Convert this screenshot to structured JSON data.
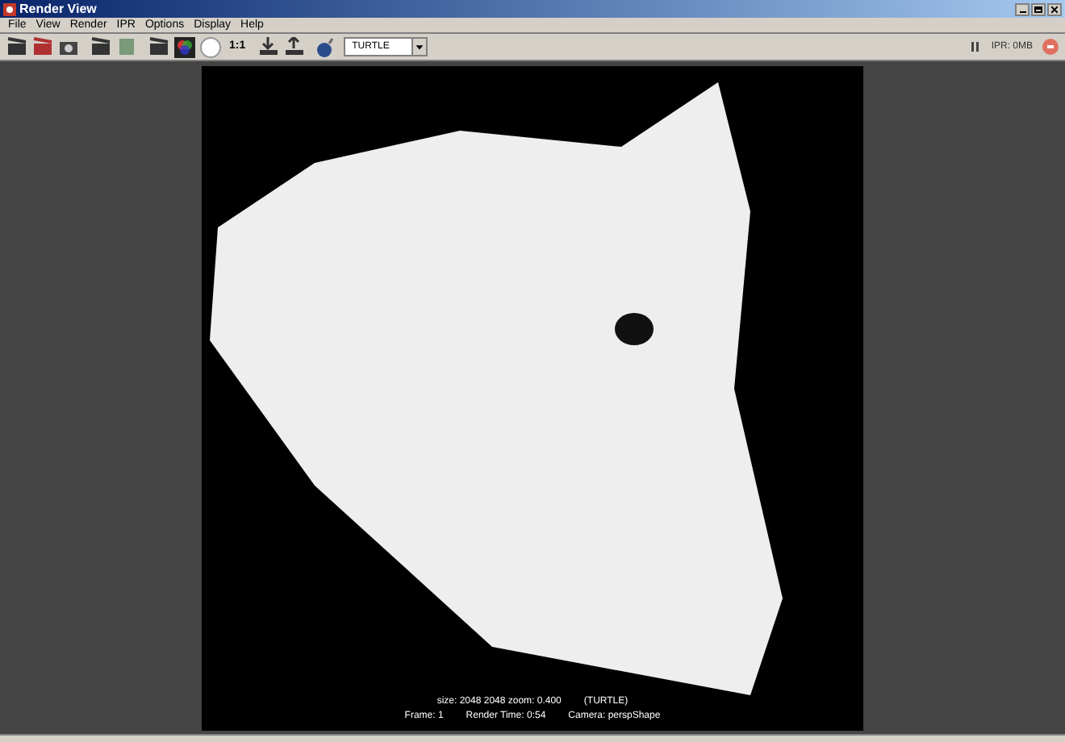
{
  "window": {
    "title": "Render View"
  },
  "menu": [
    "File",
    "View",
    "Render",
    "IPR",
    "Options",
    "Display",
    "Help"
  ],
  "toolbar": {
    "scale_label": "1:1",
    "renderer": "TURTLE",
    "ipr_status": "IPR: 0MB"
  },
  "render_info": {
    "line_1": [
      "size: 2048 2048 zoom: 0.400",
      "(TURTLE)"
    ],
    "line_2": [
      "Frame: 1",
      "Render Time: 0:54",
      "Camera: perspShape"
    ]
  }
}
